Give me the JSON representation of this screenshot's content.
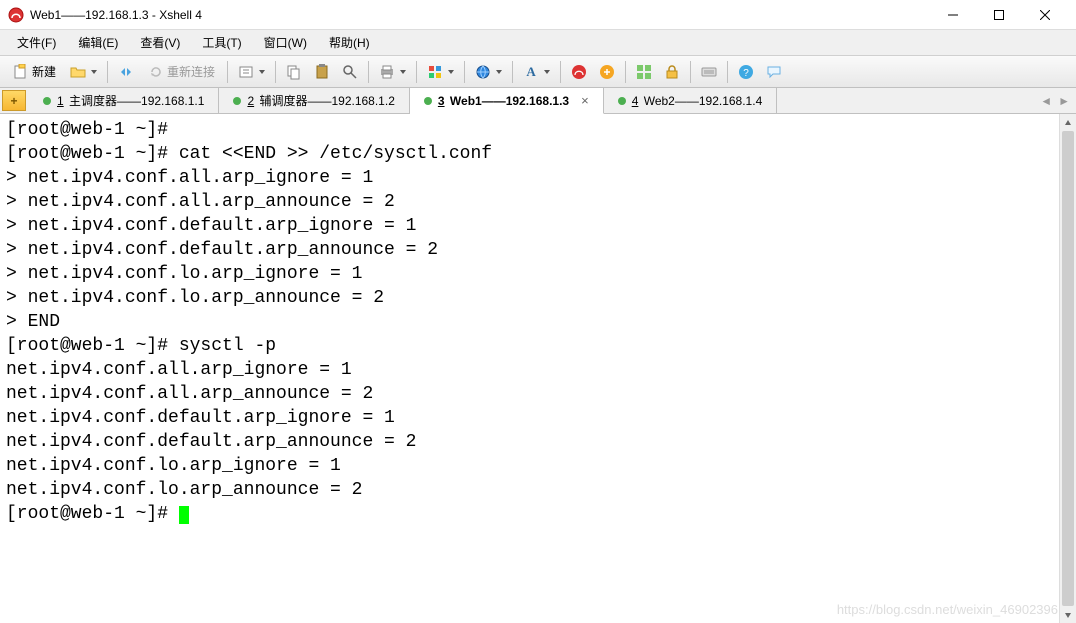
{
  "window": {
    "title": "Web1——192.168.1.3 - Xshell 4"
  },
  "menu": {
    "file": "文件(F)",
    "edit": "编辑(E)",
    "view": "查看(V)",
    "tools": "工具(T)",
    "window": "窗口(W)",
    "help": "帮助(H)"
  },
  "toolbar": {
    "new_label": "新建",
    "reconnect_label": "重新连接"
  },
  "tabs": {
    "add": "+",
    "items": [
      {
        "num": "1",
        "label": "主调度器——192.168.1.1",
        "active": false,
        "closeable": false
      },
      {
        "num": "2",
        "label": "辅调度器——192.168.1.2",
        "active": false,
        "closeable": false
      },
      {
        "num": "3",
        "label": "Web1——192.168.1.3",
        "active": true,
        "closeable": true
      },
      {
        "num": "4",
        "label": "Web2——192.168.1.4",
        "active": false,
        "closeable": false
      }
    ]
  },
  "terminal": {
    "lines": [
      "[root@web-1 ~]#",
      "[root@web-1 ~]# cat <<END >> /etc/sysctl.conf",
      "> net.ipv4.conf.all.arp_ignore = 1",
      "> net.ipv4.conf.all.arp_announce = 2",
      "> net.ipv4.conf.default.arp_ignore = 1",
      "> net.ipv4.conf.default.arp_announce = 2",
      "> net.ipv4.conf.lo.arp_ignore = 1",
      "> net.ipv4.conf.lo.arp_announce = 2",
      "> END",
      "[root@web-1 ~]# sysctl -p",
      "net.ipv4.conf.all.arp_ignore = 1",
      "net.ipv4.conf.all.arp_announce = 2",
      "net.ipv4.conf.default.arp_ignore = 1",
      "net.ipv4.conf.default.arp_announce = 2",
      "net.ipv4.conf.lo.arp_ignore = 1",
      "net.ipv4.conf.lo.arp_announce = 2",
      "[root@web-1 ~]# "
    ]
  },
  "watermark": "https://blog.csdn.net/weixin_46902396"
}
